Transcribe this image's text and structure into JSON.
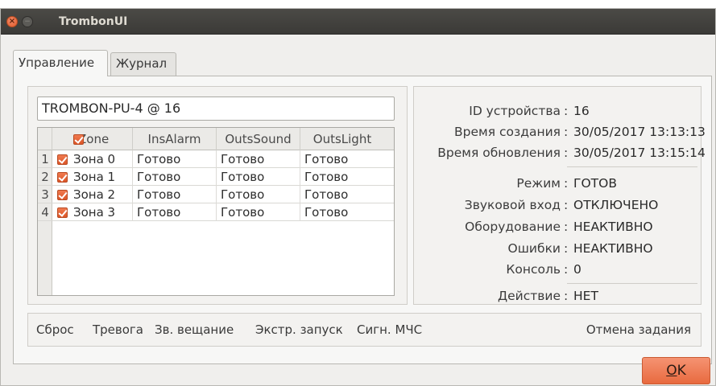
{
  "window": {
    "title": "TrombonUI",
    "close_glyph": "×",
    "min_glyph": "−"
  },
  "tabs": [
    {
      "label": "Управление",
      "active": true
    },
    {
      "label": "Журнал",
      "active": false
    }
  ],
  "device": {
    "value": "TROMBON-PU-4 @ 16"
  },
  "table": {
    "columns": [
      "Zone",
      "InsAlarm",
      "OutsSound",
      "OutsLight"
    ],
    "rows": [
      {
        "num": "1",
        "zone": "Зона 0",
        "ins": "Готово",
        "sound": "Готово",
        "light": "Готово",
        "checked": true
      },
      {
        "num": "2",
        "zone": "Зона 1",
        "ins": "Готово",
        "sound": "Готово",
        "light": "Готово",
        "checked": true
      },
      {
        "num": "3",
        "zone": "Зона 2",
        "ins": "Готово",
        "sound": "Готово",
        "light": "Готово",
        "checked": true
      },
      {
        "num": "4",
        "zone": "Зона 3",
        "ins": "Готово",
        "sound": "Готово",
        "light": "Готово",
        "checked": true
      }
    ]
  },
  "info": {
    "colon": ":",
    "fields": [
      {
        "key": "ID устройства",
        "value": "16"
      },
      {
        "key": "Время создания",
        "value": "30/05/2017 13:13:13"
      },
      {
        "key": "Время обновления",
        "value": "30/05/2017 13:15:14"
      },
      {
        "key": "Режим",
        "value": "ГОТОВ"
      },
      {
        "key": "Звуковой вход",
        "value": "ОТКЛЮЧЕНО"
      },
      {
        "key": "Оборудование",
        "value": "НЕАКТИВНО"
      },
      {
        "key": "Ошибки",
        "value": "НЕАКТИВНО"
      },
      {
        "key": "Консоль",
        "value": "0"
      },
      {
        "key": "Действие",
        "value": "НЕТ"
      }
    ]
  },
  "actions": {
    "reset": "Сброс",
    "alarm": "Тревога",
    "broadcast": "Зв. вещание",
    "emergency": "Экстр. запуск",
    "mchs": "Сигн. МЧС",
    "cancel": "Отмена задания"
  },
  "ok_button": {
    "label_first": "O",
    "label_rest": "K"
  },
  "colors": {
    "accent": "#e86a3f",
    "titlebar": "#3f3e3b",
    "background": "#f0efed"
  },
  "icons": [
    "close-icon",
    "minimize-icon",
    "checkbox-checked-icon"
  ]
}
